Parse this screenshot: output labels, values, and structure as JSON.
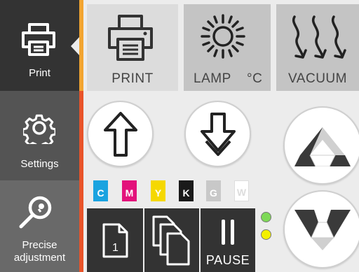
{
  "sidebar": {
    "items": [
      {
        "label": "Print",
        "icon": "printer-icon",
        "active": true
      },
      {
        "label": "Settings",
        "icon": "gear-icon"
      },
      {
        "label": "Precise adjustment",
        "icon": "magnifier-icon"
      }
    ]
  },
  "tiles": {
    "print": {
      "label": "PRINT",
      "icon": "printer-icon"
    },
    "lamp": {
      "label": "LAMP",
      "unit": "°C",
      "icon": "sun-icon"
    },
    "vacuum": {
      "label": "VACUUM",
      "icon": "vacuum-arrows-icon"
    }
  },
  "inks": [
    {
      "letter": "C",
      "color": "#1aa3e0"
    },
    {
      "letter": "M",
      "color": "#e3127b"
    },
    {
      "letter": "Y",
      "color": "#f5d800"
    },
    {
      "letter": "K",
      "color": "#1a1a1a"
    },
    {
      "letter": "G",
      "color": "#c8c8c8"
    },
    {
      "letter": "W",
      "color": "#ffffff"
    }
  ],
  "controls": {
    "single_copy": "1",
    "pause": "PAUSE"
  },
  "indicators": [
    {
      "name": "status-green",
      "color": "#7ed957"
    },
    {
      "name": "status-yellow",
      "color": "#f3f000"
    }
  ],
  "colors": {
    "sidebar_active": "#333333",
    "accent": "#f2a531",
    "accent2": "#e8542a"
  }
}
